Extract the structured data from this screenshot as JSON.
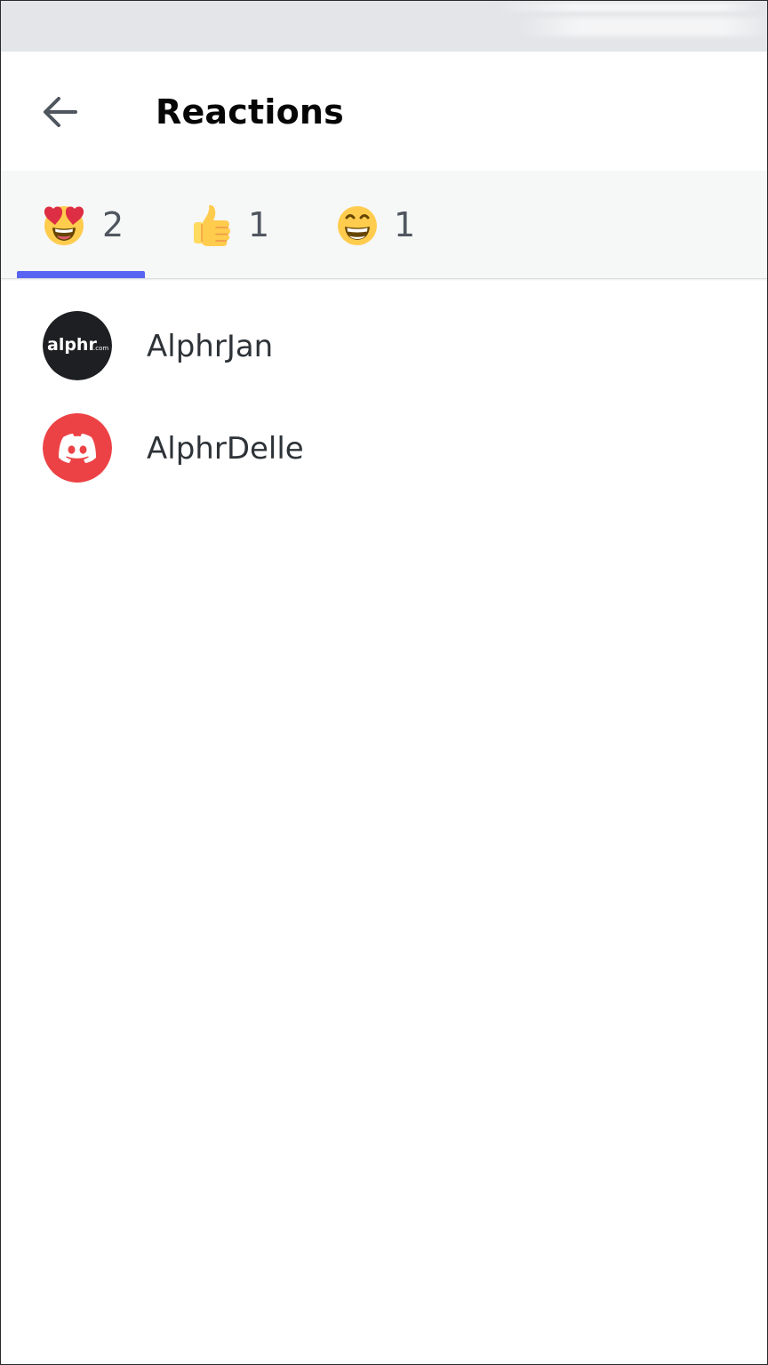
{
  "header": {
    "title": "Reactions",
    "back_icon": "arrow-left-icon"
  },
  "tabs": [
    {
      "emoji": "heart-eyes-emoji-icon",
      "count": "2",
      "selected": true
    },
    {
      "emoji": "thumbs-up-emoji-icon",
      "count": "1",
      "selected": false
    },
    {
      "emoji": "grinning-emoji-icon",
      "count": "1",
      "selected": false
    }
  ],
  "users": [
    {
      "name": "AlphrJan",
      "avatar_text": "alphr",
      "avatar_suffix": ".com",
      "avatar_color": "#1e1f22"
    },
    {
      "name": "AlphrDelle",
      "avatar_icon": "discord-logo-icon",
      "avatar_color": "#ed4245"
    }
  ],
  "colors": {
    "accent": "#5865f2",
    "tab_bar_bg": "#f6f7f7",
    "status_bar_bg": "#e3e5e8"
  }
}
